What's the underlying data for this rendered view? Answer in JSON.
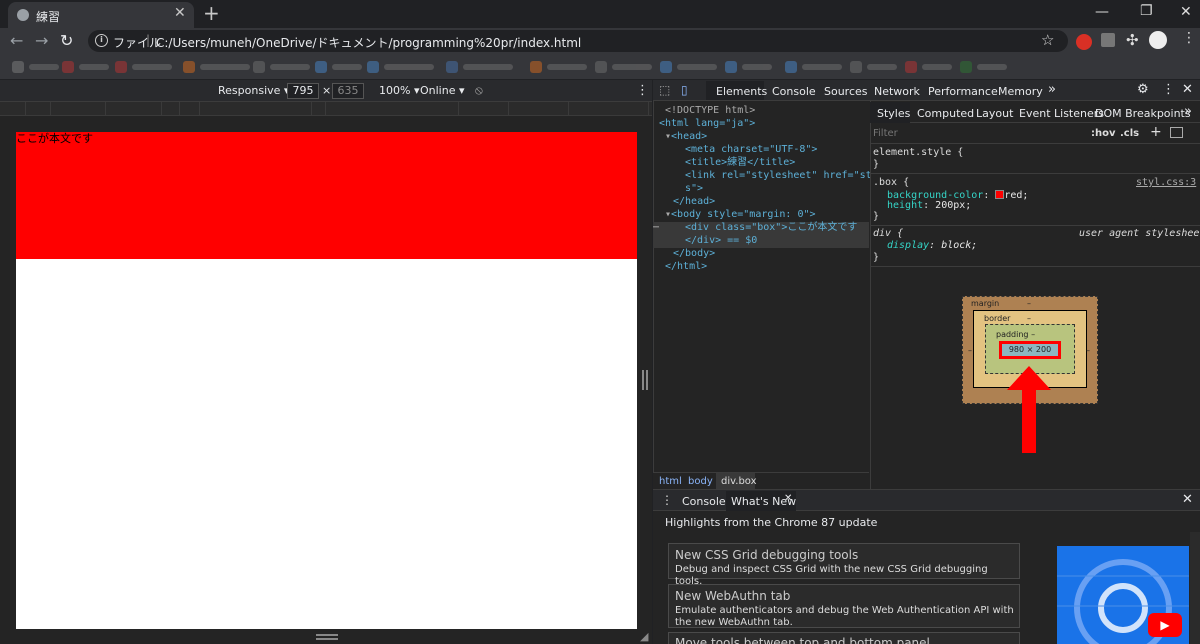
{
  "browser": {
    "tab_title": "練習",
    "address_scheme": "ファイル",
    "address_url": "C:/Users/muneh/OneDrive/ドキュメント/programming%20pr/index.html"
  },
  "device_toolbar": {
    "mode": "Responsive",
    "width": "795",
    "height": "635",
    "zoom": "100%",
    "network": "Online"
  },
  "page": {
    "box_text": "ここが本文です",
    "box_color": "#ff0000"
  },
  "devtools": {
    "tabs": [
      "Elements",
      "Console",
      "Sources",
      "Network",
      "Performance",
      "Memory"
    ],
    "tree": {
      "doctype": "<!DOCTYPE html>",
      "html_open": "<html lang=\"ja\">",
      "head_open": "<head>",
      "meta": "<meta charset=\"UTF-8\">",
      "title": "<title>練習</title>",
      "link": "<link rel=\"stylesheet\" href=\"styl.cs",
      "link_tail": "s\">",
      "head_close": "</head>",
      "body_open": "<body style=\"margin: 0\">",
      "div_line": "<div class=\"box\">ここが本文です",
      "div_close": "</div> == $0",
      "body_close": "</body>",
      "html_close": "</html>"
    },
    "breadcrumbs": [
      "html",
      "body",
      "div.box"
    ],
    "style_tabs": [
      "Styles",
      "Computed",
      "Layout",
      "Event Listeners",
      "DOM Breakpoints"
    ],
    "filter_placeholder": "Filter",
    "hov": ":hov",
    "cls": ".cls",
    "rules": {
      "element_style": "element.style {",
      "close": "}",
      "box_selector": ".box {",
      "box_source": "styl.css:3",
      "bg_prop": "background-color",
      "bg_val": "red;",
      "height_prop": "height",
      "height_val": "200px;",
      "div_selector": "div {",
      "ua_label": "user agent stylesheet",
      "display_prop": "display",
      "display_val": "block;"
    },
    "box_model": {
      "margin_label": "margin",
      "border_label": "border",
      "padding_label": "padding",
      "dash": "–",
      "content_size": "980 × 200"
    },
    "drawer": {
      "tabs": [
        "Console",
        "What's New"
      ],
      "highlights": "Highlights from the Chrome 87 update",
      "cards": [
        {
          "title": "New CSS Grid debugging tools",
          "desc": "Debug and inspect CSS Grid with the new CSS Grid debugging tools."
        },
        {
          "title": "New WebAuthn tab",
          "desc": "Emulate authenticators and debug the Web Authentication API with the new WebAuthn tab."
        },
        {
          "title": "Move tools between top and bottom panel",
          "desc": ""
        }
      ]
    }
  },
  "colors": {
    "accent_red": "#ff0000",
    "devtools_bg": "#242424",
    "link_blue": "#8ab4f8"
  }
}
